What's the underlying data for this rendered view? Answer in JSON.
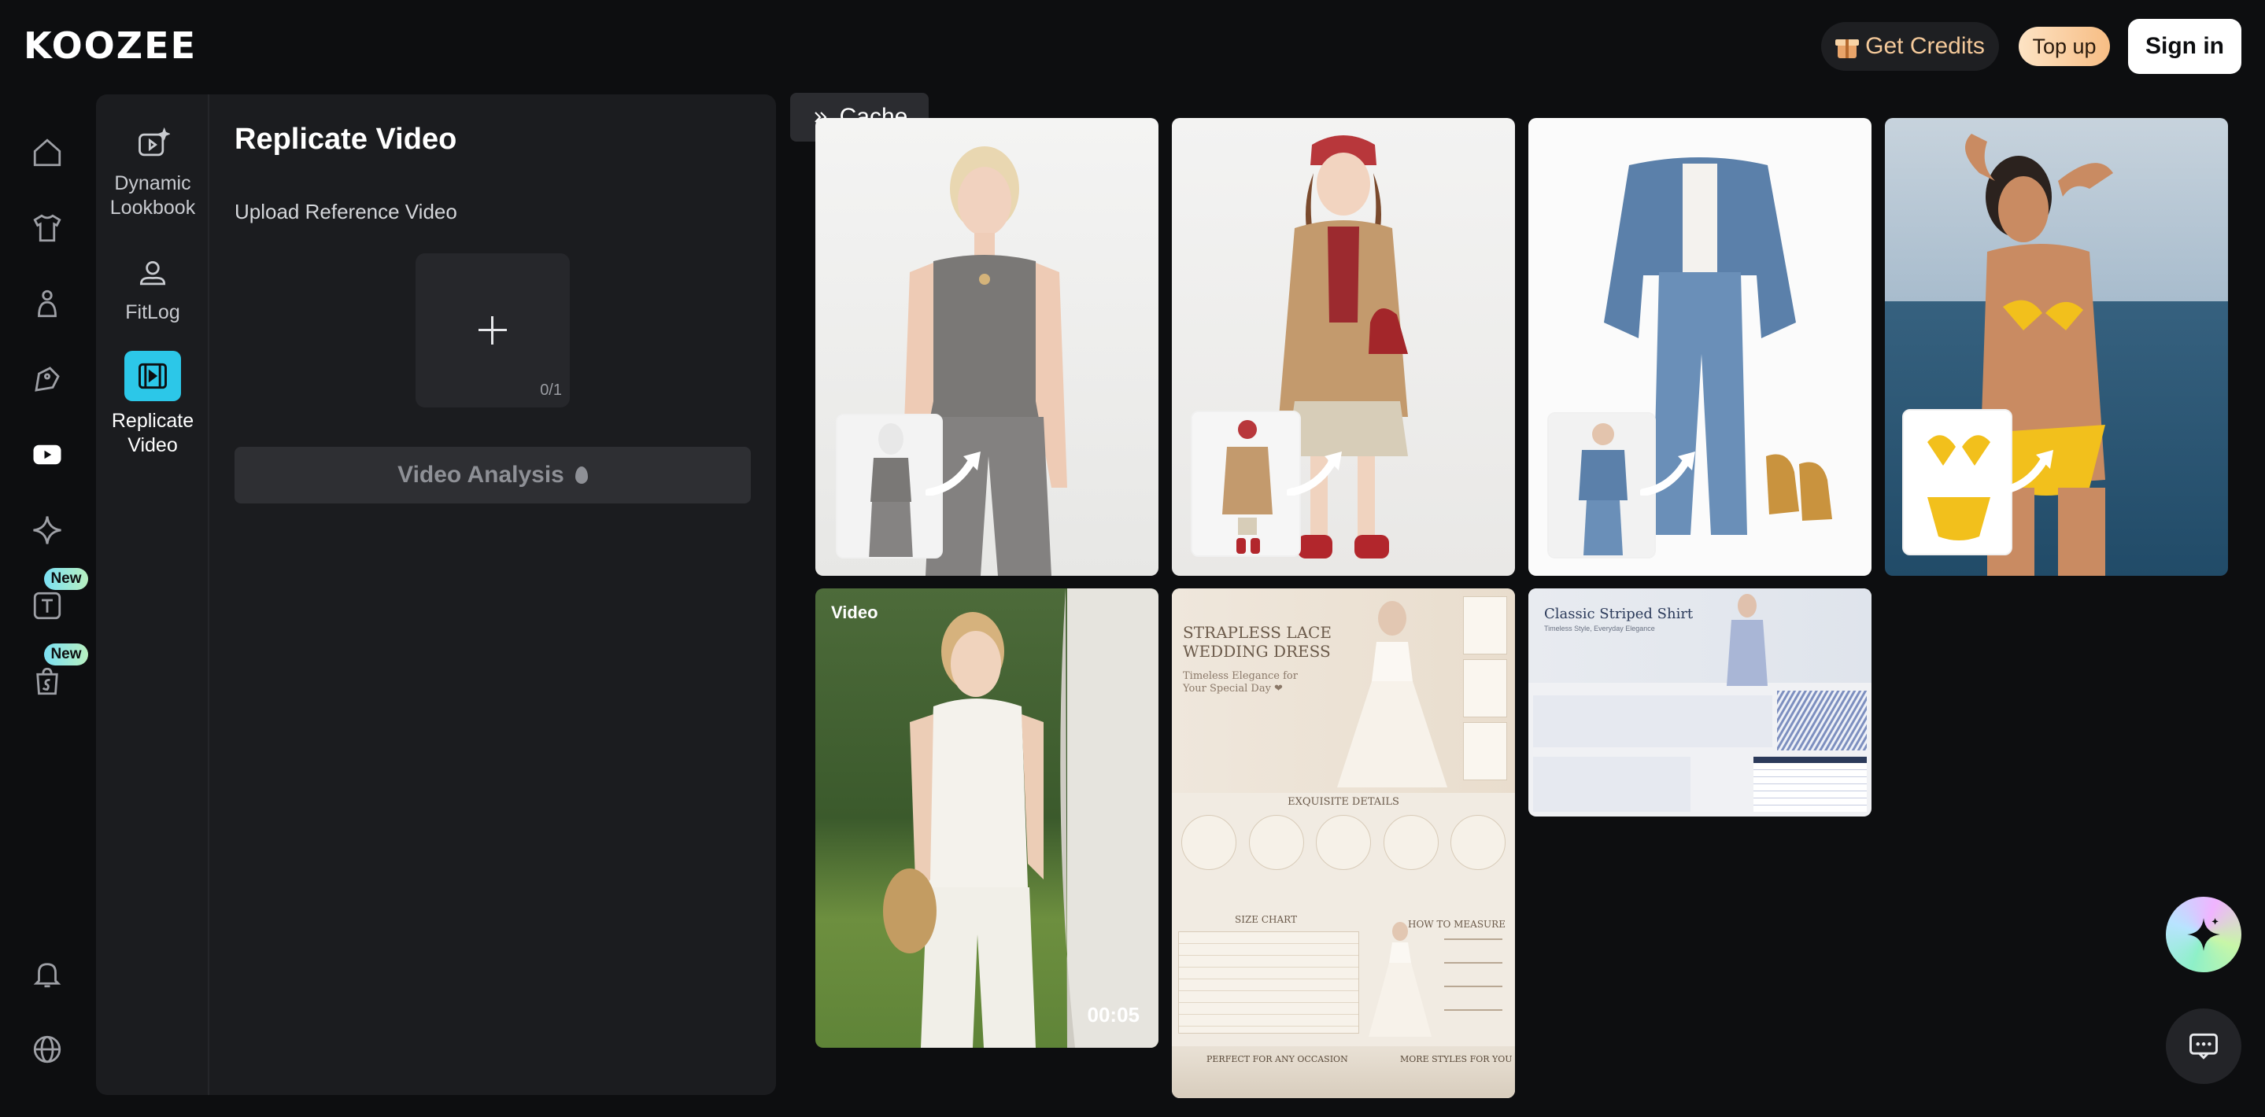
{
  "header": {
    "logo": "KOOZEE",
    "get_credits": "Get Credits",
    "top_up": "Top up",
    "sign_in": "Sign in"
  },
  "rail": {
    "badges": [
      "New",
      "New"
    ]
  },
  "subnav": {
    "items": [
      {
        "label": "Dynamic Lookbook"
      },
      {
        "label": "FitLog"
      },
      {
        "label": "Replicate Video"
      }
    ]
  },
  "panel": {
    "title": "Replicate Video",
    "upload_label": "Upload Reference Video",
    "upload_count": "0/1",
    "analysis_button": "Video Analysis"
  },
  "cache_button": "Cache",
  "gallery": {
    "video_tag": "Video",
    "video_duration": "00:05",
    "wedding": {
      "title_line1": "STRAPLESS LACE",
      "title_line2": "WEDDING DRESS",
      "subtitle": "Timeless Elegance for Your Special Day ❤",
      "details": "EXQUISITE DETAILS",
      "size_chart": "SIZE CHART",
      "how_to": "HOW TO MEASURE",
      "occasion": "PERFECT FOR ANY OCCASION",
      "more": "MORE STYLES FOR YOU"
    },
    "shirt": {
      "title": "Classic Striped Shirt",
      "subtitle": "Timeless Style, Everyday Elegance"
    }
  },
  "colors": {
    "accent": "#2cc7e8",
    "credits": "#f4c99a",
    "background": "#0d0e10",
    "panel": "#1b1c1f"
  }
}
